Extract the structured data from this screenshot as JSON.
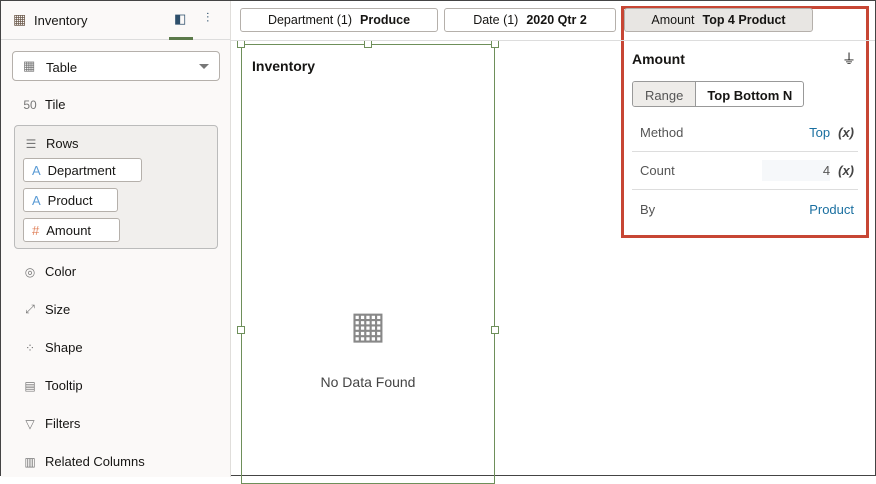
{
  "sidebar": {
    "title": "Inventory",
    "viz_type": "Table",
    "tile": "Tile",
    "rows_label": "Rows",
    "rows": [
      "Department",
      "Product",
      "Amount"
    ],
    "items": [
      "Color",
      "Size",
      "Shape",
      "Tooltip",
      "Filters",
      "Related Columns"
    ]
  },
  "filters": [
    {
      "name": "Department (1)",
      "value": "Produce"
    },
    {
      "name": "Date (1)",
      "value": "2020 Qtr 2"
    },
    {
      "name": "Amount",
      "value": "Top 4 Product"
    }
  ],
  "canvas": {
    "title": "Inventory",
    "empty": "No Data Found"
  },
  "popup": {
    "title": "Amount",
    "tabs": [
      "Range",
      "Top Bottom N"
    ],
    "method_label": "Method",
    "method": "Top",
    "count_label": "Count",
    "count": "4",
    "by_label": "By",
    "by": "Product",
    "expr": "(x)"
  },
  "colors": {
    "accent": "#c74634",
    "link": "#1a6fa0"
  }
}
